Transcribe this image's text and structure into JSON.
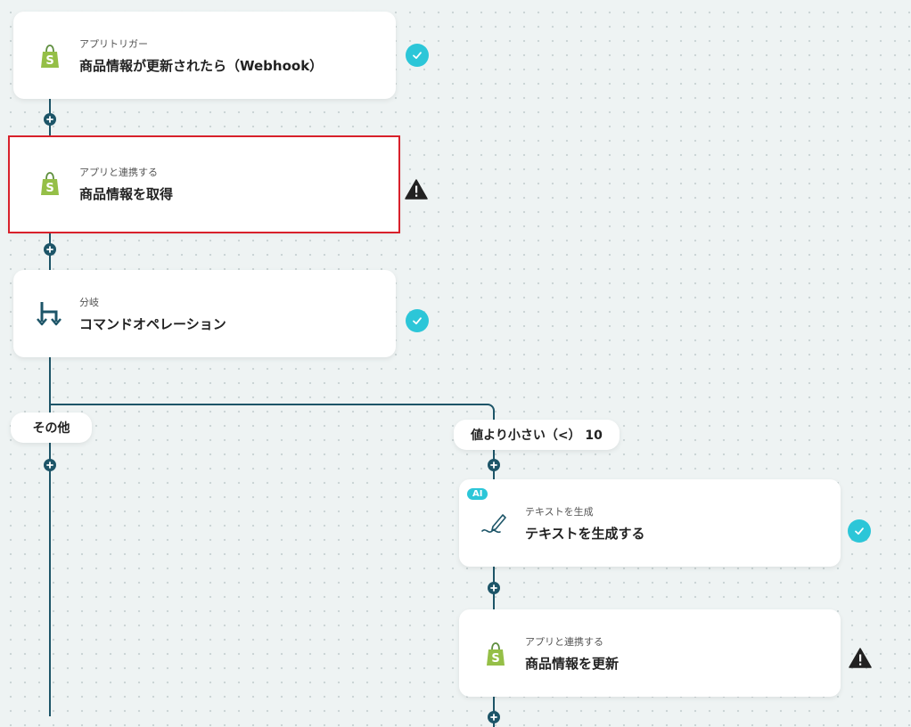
{
  "steps": [
    {
      "kind": "アプリトリガー",
      "title": "商品情報が更新されたら（Webhook）",
      "icon": "shopify-icon",
      "status": "complete"
    },
    {
      "kind": "アプリと連携する",
      "title": "商品情報を取得",
      "icon": "shopify-icon",
      "status": "warning"
    },
    {
      "kind": "分岐",
      "title": "コマンドオペレーション",
      "icon": "branch-icon",
      "status": "complete"
    }
  ],
  "branches": {
    "left_label": "その他",
    "right_label": "値より小さい（<） 10"
  },
  "right_steps": [
    {
      "badge": "AI",
      "kind": "テキストを生成",
      "title": "テキストを生成する",
      "icon": "pen-icon",
      "status": "complete"
    },
    {
      "kind": "アプリと連携する",
      "title": "商品情報を更新",
      "icon": "shopify-icon",
      "status": "warning"
    }
  ],
  "colors": {
    "line": "#1d5568",
    "check": "#2cc6d8",
    "selected_outline": "#d8212b",
    "shopify_green": "#95bf47"
  }
}
